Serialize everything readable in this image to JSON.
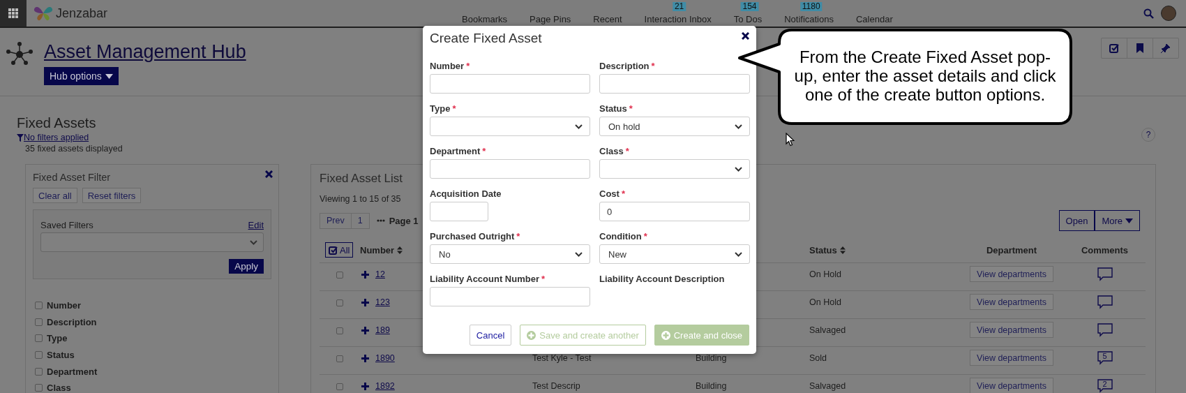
{
  "topbar": {
    "brand": "Jenzabar",
    "nav": [
      {
        "label": "Bookmarks"
      },
      {
        "label": "Page Pins"
      },
      {
        "label": "Recent"
      },
      {
        "label": "Interaction Inbox",
        "badge": "21"
      },
      {
        "label": "To Dos",
        "badge": "154"
      },
      {
        "label": "Notifications",
        "badge": "1180"
      },
      {
        "label": "Calendar"
      }
    ]
  },
  "hub": {
    "title": "Asset Management Hub",
    "options_button": "Hub options"
  },
  "page": {
    "title": "Fixed Assets",
    "filter_link": "No filters applied",
    "count": "35 fixed assets displayed",
    "help": "?"
  },
  "filter": {
    "title": "Fixed Asset Filter",
    "buttons": [
      "Clear all",
      "Reset filters"
    ],
    "saved_filters_label": "Saved Filters",
    "edit_link": "Edit",
    "apply": "Apply",
    "fields": [
      {
        "label": "Number",
        "checked": false
      },
      {
        "label": "Description",
        "checked": false
      },
      {
        "label": "Type",
        "checked": false
      },
      {
        "label": "Status",
        "checked": false
      },
      {
        "label": "Department",
        "checked": false
      },
      {
        "label": "Class",
        "checked": false
      }
    ]
  },
  "list": {
    "title": "Fixed Asset List",
    "viewing": "Viewing 1 to 15 of 35",
    "pager": [
      "Prev",
      "1"
    ],
    "page_label": "Page 1",
    "actions": [
      "Open",
      "More"
    ],
    "select_all": "All",
    "columns": [
      {
        "label": "Number",
        "sortable": true
      },
      {
        "label": "Status",
        "sortable": true
      },
      {
        "label": "Department",
        "sortable": false
      },
      {
        "label": "Comments",
        "sortable": false
      }
    ],
    "rows": [
      {
        "number": "12",
        "status": "On Hold",
        "department_button": "View departments",
        "checked": false
      },
      {
        "number": "123",
        "status": "On Hold",
        "department_button": "View departments",
        "checked": false
      },
      {
        "number": "189",
        "status": "Salvaged",
        "department_button": "View departments",
        "checked": false
      },
      {
        "number": "1890",
        "description": "Test Kyle - Test",
        "type": "Building",
        "status": "Sold",
        "department_button": "View departments",
        "comments": "5",
        "checked": false
      },
      {
        "number": "1892",
        "description": "Test Descrip",
        "type": "Building",
        "status": "Salvaged",
        "department_button": "View departments",
        "comments": "2",
        "checked": false
      }
    ]
  },
  "modal": {
    "title": "Create Fixed Asset",
    "fields": [
      {
        "label": "Number",
        "marker": "*",
        "kind": "text"
      },
      {
        "label": "Description",
        "marker": "*",
        "kind": "text"
      },
      {
        "label": "Type",
        "marker": "*",
        "kind": "select"
      },
      {
        "label": "Status",
        "marker": "*",
        "kind": "select",
        "value": "On hold"
      },
      {
        "label": "Department",
        "marker": "*",
        "kind": "text"
      },
      {
        "label": "Class",
        "marker": "*",
        "kind": "select"
      },
      {
        "label": "Acquisition Date",
        "kind": "date"
      },
      {
        "label": "Cost",
        "marker": "*",
        "kind": "text",
        "value": "0"
      },
      {
        "label": "Purchased Outright",
        "marker": "*",
        "kind": "select",
        "value": "No"
      },
      {
        "label": "Condition",
        "marker": "*",
        "kind": "select",
        "value": "New"
      },
      {
        "label": "Liability Account Number",
        "marker": "*",
        "kind": "text"
      },
      {
        "label": "Liability Account Description",
        "kind": "display"
      }
    ],
    "buttons": [
      {
        "label": "Cancel",
        "kind": "plain",
        "disabled": false
      },
      {
        "label": "Save and create another",
        "kind": "outline",
        "disabled": true
      },
      {
        "label": "Create and close",
        "kind": "filled",
        "disabled": true
      }
    ]
  },
  "callout": {
    "text": "From the Create Fixed Asset pop-up, enter the asset details and click one of the create button options."
  }
}
